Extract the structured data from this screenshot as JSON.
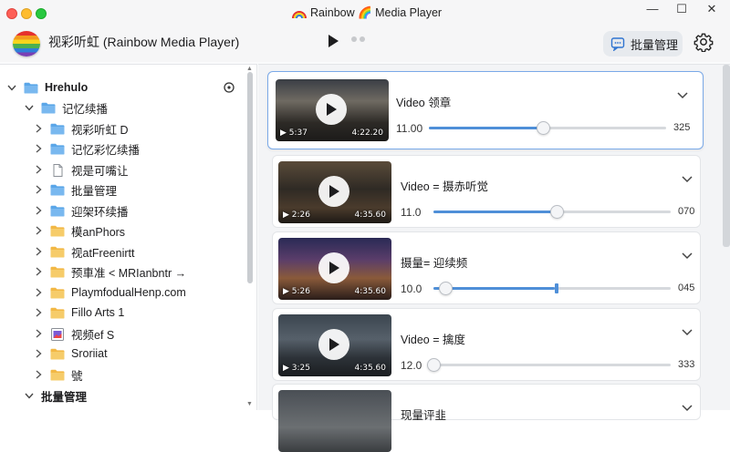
{
  "window": {
    "title": "Rainbow 🌈 Media Player"
  },
  "header": {
    "app_name": "视彩听虹 (Rainbow Media Player)",
    "batch_button": "批量管理"
  },
  "sidebar": {
    "items": [
      {
        "label": "Hrehulo",
        "level": 0,
        "expanded": true,
        "icon": "folder-icon"
      },
      {
        "label": "记忆续播",
        "level": 1,
        "expanded": true,
        "icon": "folder-icon"
      },
      {
        "label": "视彩听虹 D",
        "level": 2,
        "icon": "folder-icon"
      },
      {
        "label": "记忆彩忆续播",
        "level": 2,
        "icon": "folder-icon"
      },
      {
        "label": "视是可嘴让",
        "level": 2,
        "icon": "file-icon"
      },
      {
        "label": "批量管理",
        "level": 2,
        "icon": "folder-icon"
      },
      {
        "label": "迎架环续播",
        "level": 2,
        "icon": "folder-icon"
      },
      {
        "label": "模anPhors",
        "level": 2,
        "icon": "folder-icon"
      },
      {
        "label": "视atFreenirtt",
        "level": 2,
        "icon": "folder-icon"
      },
      {
        "label": "预車准 < MRIanbntr →",
        "level": 2,
        "icon": "folder-icon"
      },
      {
        "label": "PlaymfodualHenp.com",
        "level": 2,
        "icon": "folder-icon"
      },
      {
        "label": "Fillo Arts 1",
        "level": 2,
        "icon": "folder-icon"
      },
      {
        "label": "视频ef S",
        "level": 2,
        "icon": "image-file-icon"
      },
      {
        "label": "Sroriiat",
        "level": 2,
        "icon": "folder-icon"
      },
      {
        "label": "號",
        "level": 2,
        "icon": "folder-icon"
      },
      {
        "label": "批量管理",
        "level": 1,
        "expanded": true,
        "icon": "none"
      }
    ]
  },
  "videos": [
    {
      "title": "Video 领章",
      "thumb_left": "▶ 5:37",
      "thumb_right": "4:22.20",
      "value_left": "11.00",
      "value_right": "325",
      "progress": 0.48
    },
    {
      "title": "Video = 摄赤听觉",
      "thumb_left": "▶ 2:26",
      "thumb_right": "4:35.60",
      "value_left": "11.0",
      "value_right": "070",
      "progress": 0.52
    },
    {
      "title": "摄量= 迎续频",
      "thumb_left": "▶ 5:26",
      "thumb_right": "4:35.60",
      "value_left": "10.0",
      "value_right": "045",
      "progress": 0.51
    },
    {
      "title": "Video = 擒度",
      "thumb_left": "▶ 3:25",
      "thumb_right": "4:35.60",
      "value_left": "12.0",
      "value_right": "333",
      "progress": 0.0
    },
    {
      "title": "现量评韭",
      "thumb_left": "",
      "thumb_right": "",
      "value_left": "",
      "value_right": ""
    }
  ],
  "colors": {
    "accent": "#4f8fd8",
    "selection": "#7aa9e8",
    "folder": "#f2b845",
    "folder_blue": "#5aa6e8"
  }
}
